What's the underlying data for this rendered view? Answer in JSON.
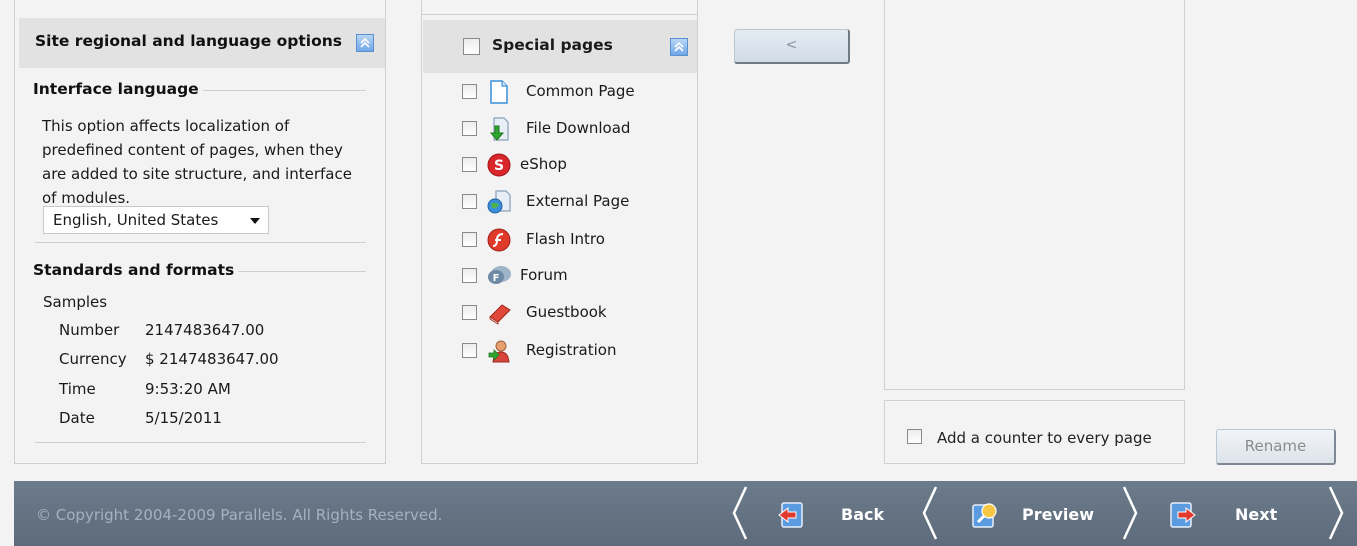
{
  "left": {
    "header_title": "Site regional and language options",
    "interface_language": {
      "title": "Interface language",
      "description": "This option affects localization of predefined content of pages, when they are added to site structure, and interface of modules.",
      "selected": "English, United States"
    },
    "standards": {
      "title": "Standards and formats",
      "samples_label": "Samples",
      "rows": [
        {
          "key": "Number",
          "value": "2147483647.00"
        },
        {
          "key": "Currency",
          "value": "$ 2147483647.00"
        },
        {
          "key": "Time",
          "value": "9:53:20 AM"
        },
        {
          "key": "Date",
          "value": "5/15/2011"
        }
      ]
    }
  },
  "middle": {
    "header_title": "Special pages",
    "pages": [
      {
        "label": "Common Page",
        "icon": "common-page-icon"
      },
      {
        "label": "File Download",
        "icon": "file-download-icon"
      },
      {
        "label": "eShop",
        "icon": "eshop-icon"
      },
      {
        "label": "External Page",
        "icon": "external-page-icon"
      },
      {
        "label": "Flash Intro",
        "icon": "flash-intro-icon"
      },
      {
        "label": "Forum",
        "icon": "forum-icon"
      },
      {
        "label": "Guestbook",
        "icon": "guestbook-icon"
      },
      {
        "label": "Registration",
        "icon": "registration-icon"
      }
    ]
  },
  "move_button_label": "<",
  "right": {
    "counter_label": "Add a counter to every page",
    "rename_label": "Rename"
  },
  "footer": {
    "copyright": "© Copyright 2004-2009 Parallels. All Rights Reserved.",
    "back_label": "Back",
    "preview_label": "Preview",
    "next_label": "Next"
  },
  "colors": {
    "footer_bg": "#65748a",
    "header_bg": "#e2e2e2",
    "accent_blue": "#6ea6e8"
  }
}
